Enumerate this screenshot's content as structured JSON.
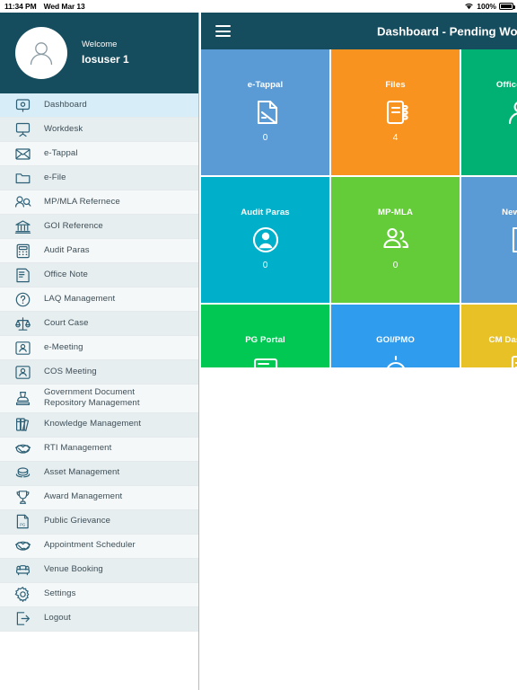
{
  "statusbar": {
    "time": "11:34 PM",
    "date": "Wed Mar 13",
    "battery_pct": "100%",
    "wifi_icon": "wifi-icon",
    "battery_icon": "battery-full-icon"
  },
  "sidebar": {
    "profile": {
      "welcome_label": "Welcome",
      "user_name": "Iosuser 1",
      "avatar_icon": "user-avatar-icon"
    },
    "items": [
      {
        "label": "Dashboard",
        "icon": "dashboard-icon",
        "active": true
      },
      {
        "label": "Workdesk",
        "icon": "workdesk-icon",
        "active": false
      },
      {
        "label": "e-Tappal",
        "icon": "envelope-icon",
        "active": false
      },
      {
        "label": "e-File",
        "icon": "folder-icon",
        "active": false
      },
      {
        "label": "MP/MLA Refernece",
        "icon": "people-search-icon",
        "active": false
      },
      {
        "label": "GOI Reference",
        "icon": "bank-icon",
        "active": false
      },
      {
        "label": "Audit Paras",
        "icon": "calculator-icon",
        "active": false
      },
      {
        "label": "Office Note",
        "icon": "note-icon",
        "active": false
      },
      {
        "label": "LAQ Management",
        "icon": "question-circle-icon",
        "active": false
      },
      {
        "label": "Court Case",
        "icon": "scales-icon",
        "active": false
      },
      {
        "label": "e-Meeting",
        "icon": "presentation-icon",
        "active": false
      },
      {
        "label": "COS Meeting",
        "icon": "presentation-icon",
        "active": false
      },
      {
        "label": "Government Document\nRepository Management",
        "icon": "stamp-icon",
        "active": false
      },
      {
        "label": "Knowledge Management",
        "icon": "books-icon",
        "active": false
      },
      {
        "label": "RTI Management",
        "icon": "handshake-icon",
        "active": false
      },
      {
        "label": "Asset Management",
        "icon": "coins-icon",
        "active": false
      },
      {
        "label": "Award Management",
        "icon": "trophy-icon",
        "active": false
      },
      {
        "label": "Public Grievance",
        "icon": "pg-document-icon",
        "active": false
      },
      {
        "label": "Appointment Scheduler",
        "icon": "handshake-icon",
        "active": false
      },
      {
        "label": "Venue Booking",
        "icon": "sofa-icon",
        "active": false
      },
      {
        "label": "Settings",
        "icon": "gear-icon",
        "active": false
      },
      {
        "label": "Logout",
        "icon": "logout-icon",
        "active": false
      }
    ]
  },
  "main": {
    "menu_button_icon": "hamburger-menu-icon",
    "title": "Dashboard - Pending Work",
    "tiles": [
      [
        {
          "label": "e-Tappal",
          "count": "0",
          "color": "#5b9bd5",
          "icon": "tappal-page-icon"
        },
        {
          "label": "Files",
          "count": "4",
          "color": "#f7931e",
          "icon": "file-book-icon"
        },
        {
          "label": "Office Note",
          "count": "",
          "color": "#00b173",
          "icon": "office-note-icon"
        }
      ],
      [
        {
          "label": "Audit Paras",
          "count": "0",
          "color": "#00b0ca",
          "icon": "person-circle-icon"
        },
        {
          "label": "MP-MLA",
          "count": "0",
          "color": "#63cc38",
          "icon": "people-group-icon"
        },
        {
          "label": "New File",
          "count": "",
          "color": "#5b9bd5",
          "icon": "new-file-icon"
        }
      ],
      [
        {
          "label": "PG Portal",
          "count": "",
          "color": "#00c853",
          "icon": "pg-portal-icon"
        },
        {
          "label": "GOI/PMO",
          "count": "",
          "color": "#2f9ced",
          "icon": "goi-pmo-icon"
        },
        {
          "label": "CM Dashboard",
          "count": "",
          "color": "#e8c127",
          "icon": "cm-dashboard-icon"
        }
      ]
    ]
  }
}
